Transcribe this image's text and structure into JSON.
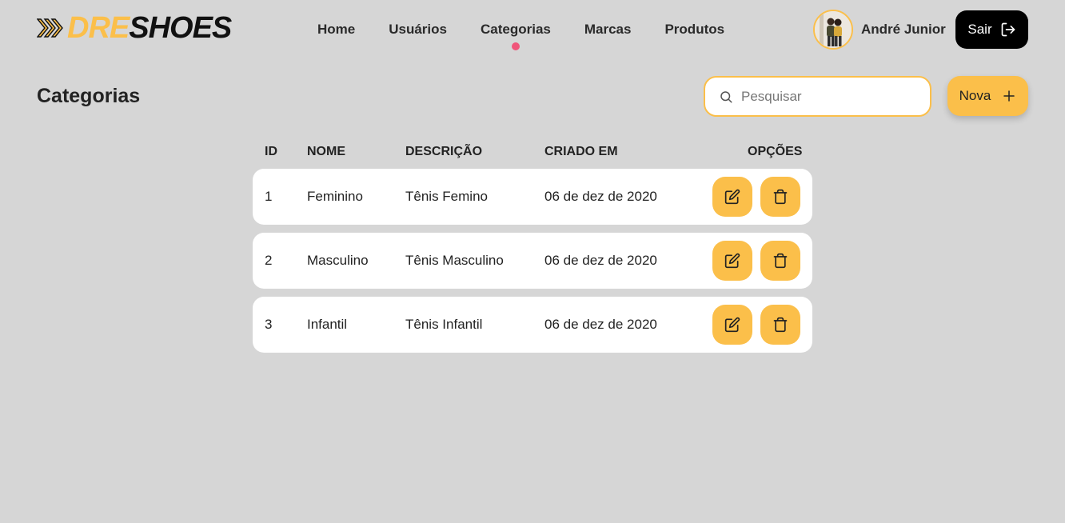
{
  "brand": {
    "part1": "DRE",
    "part2": "SHOES",
    "accent": "#fbbf4a"
  },
  "nav": {
    "items": [
      "Home",
      "Usuários",
      "Categorias",
      "Marcas",
      "Produtos"
    ],
    "active_index": 2,
    "active_dot_color": "#f0557a"
  },
  "user": {
    "name": "André Junior"
  },
  "logout": {
    "label": "Sair"
  },
  "page": {
    "title": "Categorias"
  },
  "search": {
    "placeholder": "Pesquisar",
    "value": ""
  },
  "new_button": {
    "label": "Nova"
  },
  "table": {
    "columns": {
      "id": "ID",
      "nome": "NOME",
      "descricao": "DESCRIÇÃO",
      "criado_em": "CRIADO EM",
      "opcoes": "OPÇÕES"
    },
    "rows": [
      {
        "id": "1",
        "nome": "Feminino",
        "descricao": "Tênis Femino",
        "criado_em": "06 de dez de 2020"
      },
      {
        "id": "2",
        "nome": "Masculino",
        "descricao": "Tênis Masculino",
        "criado_em": "06 de dez de 2020"
      },
      {
        "id": "3",
        "nome": "Infantil",
        "descricao": "Tênis Infantil",
        "criado_em": "06 de dez de 2020"
      }
    ]
  },
  "icons": {
    "logo": "chevrons-right-icon",
    "logout": "log-out-icon",
    "search": "search-icon",
    "new": "plus-icon",
    "edit": "edit-icon",
    "delete": "trash-icon"
  }
}
